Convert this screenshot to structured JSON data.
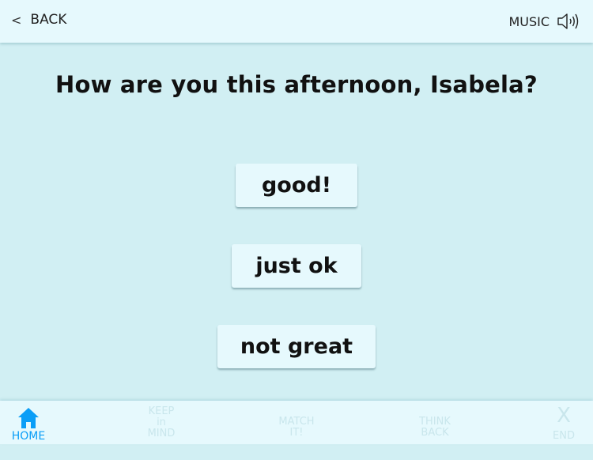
{
  "topbar": {
    "back_label": "BACK",
    "back_icon": "chevron-left-icon",
    "music_label": "MUSIC",
    "music_icon": "speaker-icon"
  },
  "prompt": {
    "question": "How are you this afternoon, Isabela?"
  },
  "answers": [
    {
      "label": "good!"
    },
    {
      "label": "just ok"
    },
    {
      "label": "not great"
    }
  ],
  "nav": {
    "active_color": "#0a9ef7",
    "inactive_color": "#c9e6ec",
    "tabs": [
      {
        "label": "HOME",
        "icon": "home-icon",
        "active": true
      },
      {
        "line1": "KEEP",
        "line2": "in",
        "line3": "MIND",
        "active": false
      },
      {
        "line1": "MATCH",
        "line2": "IT!",
        "active": false
      },
      {
        "line1": "THINK",
        "line2": "BACK",
        "active": false
      },
      {
        "icon_text": "X",
        "label": "END",
        "active": false
      }
    ]
  }
}
